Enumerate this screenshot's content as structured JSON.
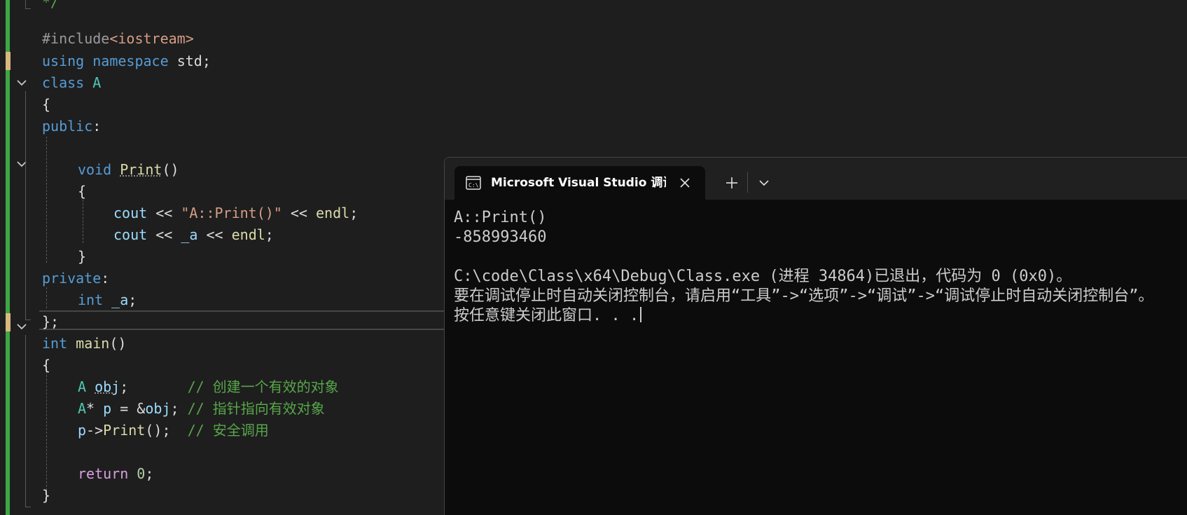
{
  "editor": {
    "top_comment": "*/",
    "include_directive": "#include",
    "include_header": "<iostream>",
    "using": {
      "kw1": "using",
      "kw2": "namespace",
      "ns": "std",
      "semi": ";"
    },
    "class_line": {
      "kw": "class",
      "name": "A"
    },
    "open_brace": "{",
    "close_brace": "}",
    "class_close": "};",
    "access_public": "public",
    "access_private": "private",
    "colon": ":",
    "print_decl": {
      "type": "void",
      "name": "Print",
      "parens": "()"
    },
    "cout1": {
      "obj": "cout",
      "op1": " << ",
      "str": "\"A::Print()\"",
      "op2": " << ",
      "endl": "endl",
      "semi": ";"
    },
    "cout2": {
      "obj": "cout",
      "op1": " << ",
      "member": "_a",
      "op2": " << ",
      "endl": "endl",
      "semi": ";"
    },
    "member_decl": {
      "type": "int",
      "name": "_a",
      "semi": ";"
    },
    "main_decl": {
      "type": "int",
      "name": "main",
      "parens": "()"
    },
    "obj_line": {
      "type": "A",
      "var": "obj",
      "semi": ";",
      "pad": "       ",
      "comment": "// 创建一个有效的对象"
    },
    "ptr_line": {
      "type": "A",
      "star": "* ",
      "var": "p",
      "assign": " = &",
      "target": "obj",
      "semi": "; ",
      "comment": "// 指针指向有效对象"
    },
    "call_line": {
      "var": "p",
      "arrow": "->",
      "fn": "Print",
      "rest": "();  ",
      "comment": "// 安全调用"
    },
    "return_line": {
      "kw": "return",
      "value": "0",
      "semi": ";"
    }
  },
  "terminal": {
    "tab_title": "Microsoft Visual Studio 调试控制台",
    "icon": "console-icon",
    "close_icon": "close-icon",
    "new_tab_icon": "plus-icon",
    "dropdown_icon": "chevron-down-icon",
    "lines": [
      "A::Print()",
      "-858993460",
      "",
      "C:\\code\\Class\\x64\\Debug\\Class.exe (进程 34864)已退出，代码为 0 (0x0)。",
      "要在调试停止时自动关闭控制台，请启用“工具”->“选项”->“调试”->“调试停止时自动关闭控制台”。",
      "按任意键关闭此窗口. . ."
    ]
  },
  "colors": {
    "keyword": "#569cd6",
    "type": "#4ec9b0",
    "function": "#dcdcaa",
    "string": "#d69d85",
    "comment": "#57a64a",
    "control": "#d8a0df",
    "change_bar": "#3ea744"
  }
}
